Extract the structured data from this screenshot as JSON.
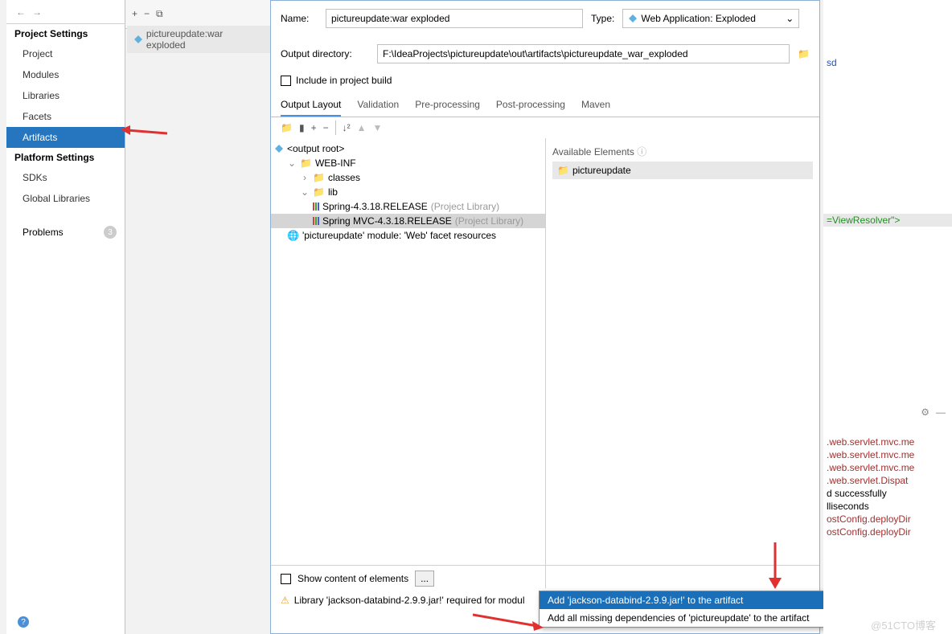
{
  "nav": {
    "projectSettings": "Project Settings",
    "items1": [
      "Project",
      "Modules",
      "Libraries",
      "Facets",
      "Artifacts"
    ],
    "platformSettings": "Platform Settings",
    "items2": [
      "SDKs",
      "Global Libraries"
    ],
    "problems": "Problems",
    "problemsCount": "3"
  },
  "tab": {
    "label": "pictureupdate:war exploded"
  },
  "form": {
    "nameLabel": "Name:",
    "nameValue": "pictureupdate:war exploded",
    "typeLabel": "Type:",
    "typeValue": "Web Application: Exploded",
    "outDirLabel": "Output directory:",
    "outDirValue": "F:\\IdeaProjects\\pictureupdate\\out\\artifacts\\pictureupdate_war_exploded",
    "includeBuild": "Include in project build"
  },
  "tabs": [
    "Output Layout",
    "Validation",
    "Pre-processing",
    "Post-processing",
    "Maven"
  ],
  "tree": {
    "root": "<output root>",
    "webinf": "WEB-INF",
    "classes": "classes",
    "lib": "lib",
    "spring": "Spring-4.3.18.RELEASE",
    "springmvc": "Spring MVC-4.3.18.RELEASE",
    "libSuffix": " (Project Library)",
    "facet": "'pictureupdate' module: 'Web' facet resources"
  },
  "avail": {
    "header": "Available Elements",
    "item": "pictureupdate"
  },
  "bottom": {
    "showContent": "Show content of elements",
    "dots": "..."
  },
  "warning": "Library 'jackson-databind-2.9.9.jar!' required for modul",
  "menu": {
    "item1": "Add 'jackson-databind-2.9.9.jar!' to the artifact",
    "item2": "Add all missing dependencies of 'pictureupdate' to the artifact"
  },
  "code": {
    "l1": "sd",
    "l2": "=ViewResolver\">",
    "l3": ".web.servlet.mvc.me",
    "l4": ".web.servlet.mvc.me",
    "l5": ".web.servlet.mvc.me",
    "l6": ".web.servlet.Dispat",
    "l7": "d successfully",
    "l8": "lliseconds",
    "l9": "ostConfig.deployDir",
    "l10": "ostConfig.deployDir"
  },
  "watermark": "@51CTO博客"
}
